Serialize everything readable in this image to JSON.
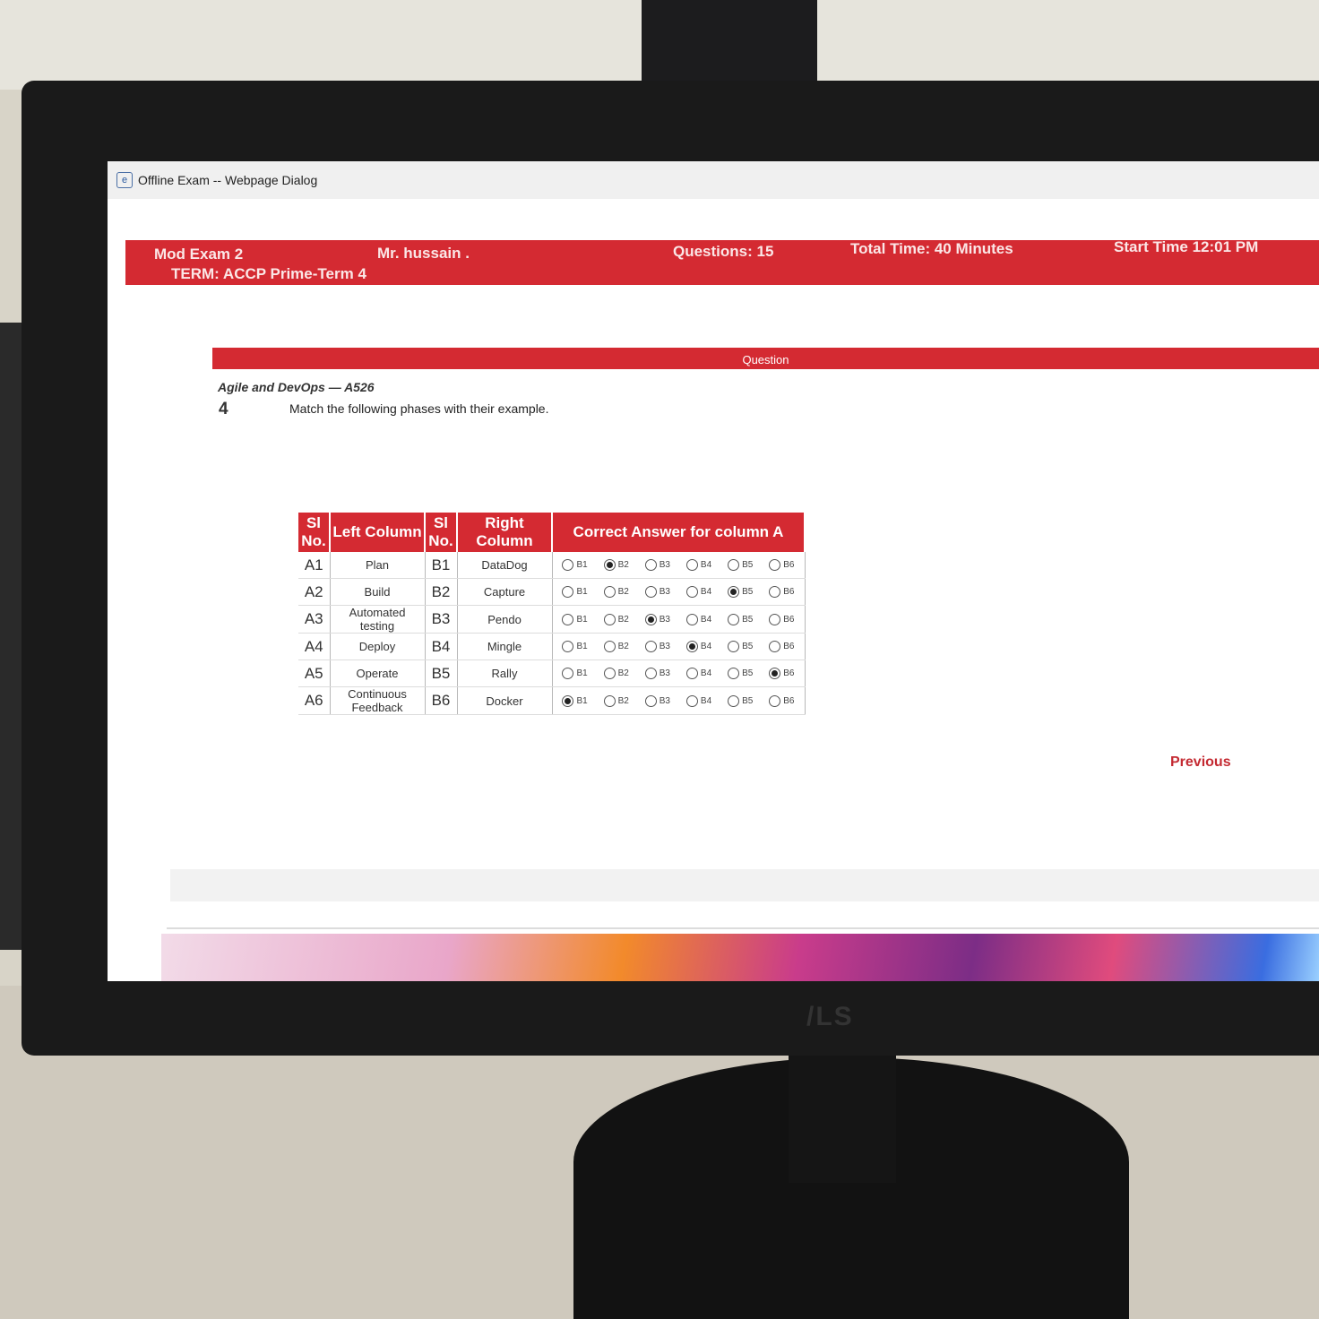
{
  "window": {
    "title": "Offline Exam -- Webpage Dialog"
  },
  "header": {
    "exam_name": "Mod Exam 2",
    "term": "TERM: ACCP Prime-Term 4",
    "instructor": "Mr. hussain .",
    "questions_label": "Questions:",
    "questions_value": "15",
    "total_time_label": "Total Time:",
    "total_time_value": "40 Minutes",
    "start_time_label": "Start Time",
    "start_time_value": "12:01 PM"
  },
  "question": {
    "bar_label": "Question",
    "subject": "Agile and DevOps — A526",
    "number": "4",
    "text": "Match the following phases with their example."
  },
  "table": {
    "headers": {
      "sl_left": "Sl No.",
      "left_column": "Left Column",
      "sl_right": "Sl No.",
      "right_column": "Right Column",
      "answer": "Correct Answer for column A"
    },
    "rows": [
      {
        "left_id": "A1",
        "left": "Plan",
        "right_id": "B1",
        "right": "DataDog",
        "selected": "B2"
      },
      {
        "left_id": "A2",
        "left": "Build",
        "right_id": "B2",
        "right": "Capture",
        "selected": "B5"
      },
      {
        "left_id": "A3",
        "left": "Automated testing",
        "right_id": "B3",
        "right": "Pendo",
        "selected": "B3"
      },
      {
        "left_id": "A4",
        "left": "Deploy",
        "right_id": "B4",
        "right": "Mingle",
        "selected": "B4"
      },
      {
        "left_id": "A5",
        "left": "Operate",
        "right_id": "B5",
        "right": "Rally",
        "selected": "B6"
      },
      {
        "left_id": "A6",
        "left": "Continuous Feedback",
        "right_id": "B6",
        "right": "Docker",
        "selected": "B1"
      }
    ],
    "options": [
      "B1",
      "B2",
      "B3",
      "B4",
      "B5",
      "B6"
    ]
  },
  "nav": {
    "previous": "Previous"
  },
  "colors": {
    "accent": "#d42a32",
    "text": "#333333"
  }
}
